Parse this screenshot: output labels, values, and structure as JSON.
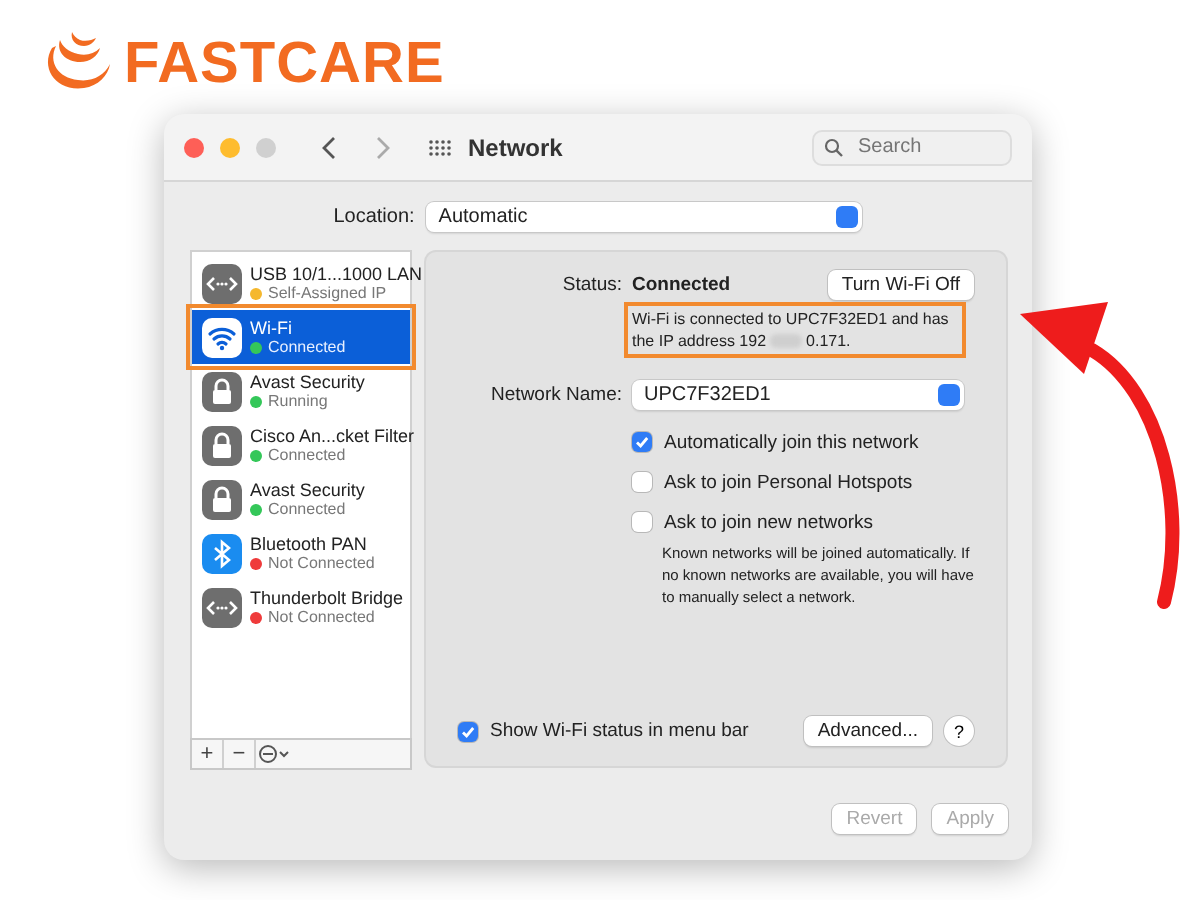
{
  "logo": {
    "text": "FASTCARE"
  },
  "window": {
    "title": "Network",
    "search": {
      "placeholder": "Search"
    }
  },
  "location": {
    "label": "Location:",
    "value": "Automatic"
  },
  "services": [
    {
      "name": "USB 10/1...1000 LAN",
      "status": "Self-Assigned IP",
      "color": "#f5b82e",
      "kind": "ethernet",
      "selected": false,
      "highlighted": false
    },
    {
      "name": "Wi-Fi",
      "status": "Connected",
      "color": "#34c759",
      "kind": "wifi",
      "selected": true,
      "highlighted": true
    },
    {
      "name": "Avast Security",
      "status": "Running",
      "color": "#34c759",
      "kind": "lock",
      "selected": false,
      "highlighted": false
    },
    {
      "name": "Cisco An...cket Filter",
      "status": "Connected",
      "color": "#34c759",
      "kind": "lock",
      "selected": false,
      "highlighted": false
    },
    {
      "name": "Avast Security",
      "status": "Connected",
      "color": "#34c759",
      "kind": "lock",
      "selected": false,
      "highlighted": false
    },
    {
      "name": "Bluetooth PAN",
      "status": "Not Connected",
      "color": "#ef3b3b",
      "kind": "bluetooth",
      "selected": false,
      "highlighted": false
    },
    {
      "name": "Thunderbolt Bridge",
      "status": "Not Connected",
      "color": "#ef3b3b",
      "kind": "ethernet",
      "selected": false,
      "highlighted": false
    }
  ],
  "sidebar_toolbar": {
    "add": "+",
    "remove": "−"
  },
  "status": {
    "label": "Status:",
    "value": "Connected",
    "button": "Turn Wi-Fi Off",
    "description_start": "Wi-Fi is connected to UPC7F32ED1 and has the IP address 192",
    "description_end": "0.171.",
    "highlighted": true
  },
  "network_name": {
    "label": "Network Name:",
    "value": "UPC7F32ED1"
  },
  "options": [
    {
      "label": "Automatically join this network",
      "checked": true
    },
    {
      "label": "Ask to join Personal Hotspots",
      "checked": false
    },
    {
      "label": "Ask to join new networks",
      "checked": false
    }
  ],
  "note": "Known networks will be joined automatically. If no known networks are available, you will have to manually select a network.",
  "show_status": {
    "label": "Show Wi-Fi status in menu bar",
    "checked": true
  },
  "advanced_button": "Advanced...",
  "help_button": "?",
  "footer": [
    {
      "label": "Revert",
      "disabled": true
    },
    {
      "label": "Apply",
      "disabled": true
    }
  ]
}
